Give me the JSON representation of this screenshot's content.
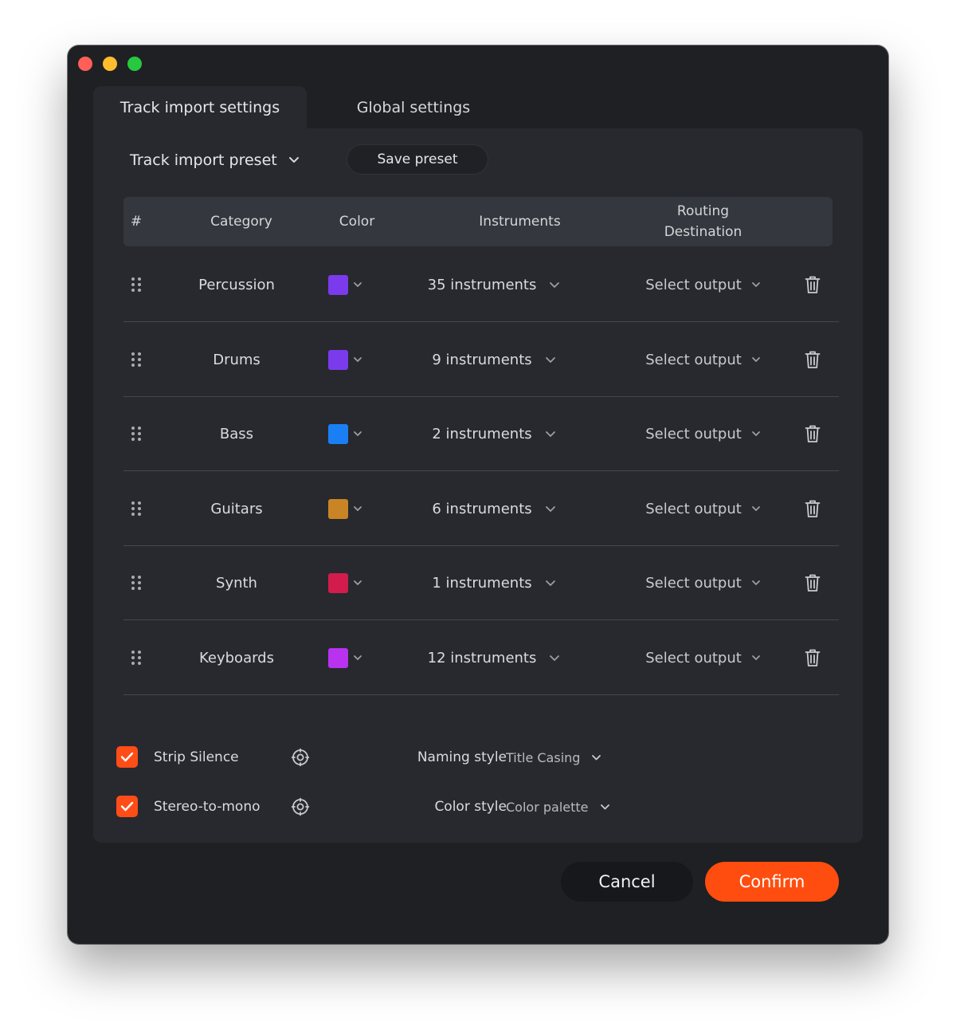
{
  "window": {
    "tabs": [
      {
        "label": "Track import settings",
        "active": true
      },
      {
        "label": "Global settings",
        "active": false
      }
    ]
  },
  "preset": {
    "select_label": "Track import preset",
    "save_label": "Save preset"
  },
  "table": {
    "headers": {
      "num": "#",
      "category": "Category",
      "color": "Color",
      "instruments": "Instruments",
      "routing_line1": "Routing",
      "routing_line2": "Destination"
    },
    "rows": [
      {
        "category": "Percussion",
        "color": "#7c3aed",
        "instruments": "35 instruments",
        "routing": "Select output"
      },
      {
        "category": "Drums",
        "color": "#7c3aed",
        "instruments": "9 instruments",
        "routing": "Select output"
      },
      {
        "category": "Bass",
        "color": "#1a7ff5",
        "instruments": "2 instruments",
        "routing": "Select output"
      },
      {
        "category": "Guitars",
        "color": "#c98425",
        "instruments": "6 instruments",
        "routing": "Select output"
      },
      {
        "category": "Synth",
        "color": "#d11c4c",
        "instruments": "1 instruments",
        "routing": "Select output"
      },
      {
        "category": "Keyboards",
        "color": "#b832f0",
        "instruments": "12 instruments",
        "routing": "Select output"
      }
    ]
  },
  "options": {
    "strip_silence": {
      "label": "Strip Silence",
      "checked": true
    },
    "stereo_to_mono": {
      "label": "Stereo-to-mono",
      "checked": true
    },
    "naming_style": {
      "label": "Naming style",
      "value": "Title Casing"
    },
    "color_style": {
      "label": "Color style",
      "value": "Color palette"
    }
  },
  "footer": {
    "cancel_label": "Cancel",
    "confirm_label": "Confirm"
  },
  "colors": {
    "accent": "#ff4d0f",
    "window_bg": "#1e2024",
    "panel_bg": "#27292e",
    "header_bg": "#34373d"
  },
  "icons": {
    "drag": "drag-handle-icon",
    "chevron": "chevron-down-icon",
    "trash": "trash-icon",
    "gear": "gear-icon",
    "check": "checkmark-icon"
  }
}
